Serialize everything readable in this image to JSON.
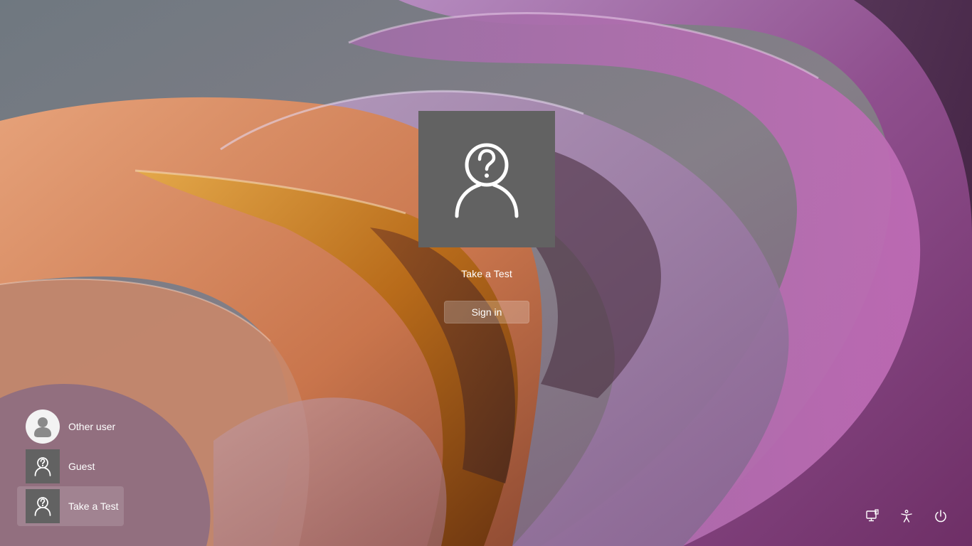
{
  "signin": {
    "username": "Take a Test",
    "button_label": "Sign in",
    "avatar_icon": "user-question-icon"
  },
  "users": [
    {
      "name": "Other user",
      "icon": "person-silhouette-icon",
      "selected": false
    },
    {
      "name": "Guest",
      "icon": "user-question-icon",
      "selected": false
    },
    {
      "name": "Take a Test",
      "icon": "user-question-icon",
      "selected": true
    }
  ],
  "controls": [
    {
      "icon": "network-icon"
    },
    {
      "icon": "accessibility-icon"
    },
    {
      "icon": "power-icon"
    }
  ],
  "colors": {
    "avatar_bg": "#626262",
    "text": "#ffffff",
    "wallpaper_purple": "#a2579b",
    "wallpaper_orange": "#d9895a",
    "wallpaper_gray": "#7a7f86"
  }
}
